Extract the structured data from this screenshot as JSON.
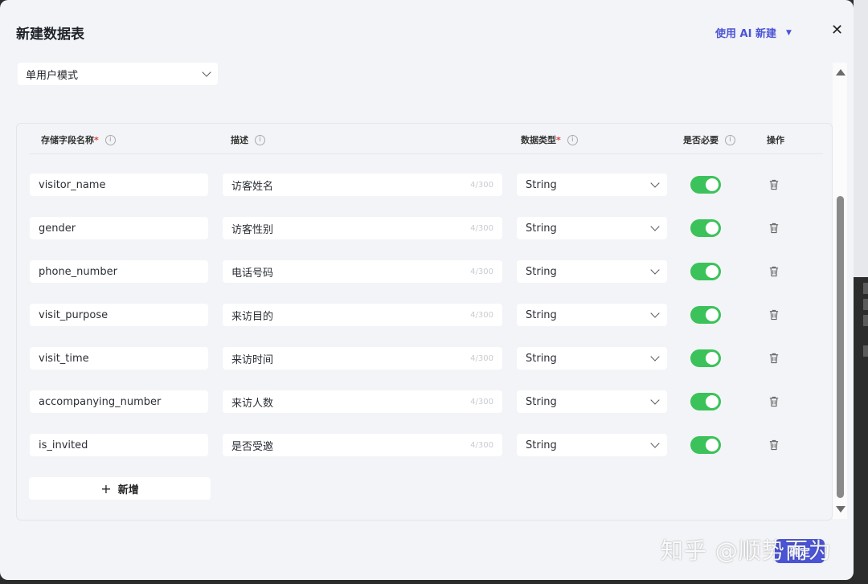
{
  "dialog": {
    "title": "新建数据表",
    "ai_new_label": "使用 AI 新建",
    "close_label": "✕",
    "mode_select": "单用户模式",
    "confirm_label": "确定"
  },
  "table": {
    "headers": {
      "name": "存储字段名称",
      "desc": "描述",
      "type": "数据类型",
      "required": "是否必要",
      "ops": "操作"
    },
    "required_mark": "*",
    "info_glyph": "i",
    "rows": [
      {
        "name": "visitor_name",
        "desc": "访客姓名",
        "count": "4/300",
        "type": "String",
        "required": true
      },
      {
        "name": "gender",
        "desc": "访客性别",
        "count": "4/300",
        "type": "String",
        "required": true
      },
      {
        "name": "phone_number",
        "desc": "电话号码",
        "count": "4/300",
        "type": "String",
        "required": true
      },
      {
        "name": "visit_purpose",
        "desc": "来访目的",
        "count": "4/300",
        "type": "String",
        "required": true
      },
      {
        "name": "visit_time",
        "desc": "来访时间",
        "count": "4/300",
        "type": "String",
        "required": true
      },
      {
        "name": "accompanying_number",
        "desc": "来访人数",
        "count": "4/300",
        "type": "String",
        "required": true
      },
      {
        "name": "is_invited",
        "desc": "是否受邀",
        "count": "4/300",
        "type": "String",
        "required": true
      }
    ],
    "add_label": "新增",
    "add_glyph": "+"
  },
  "watermark": "知乎 @顺势而为",
  "colors": {
    "accent": "#4b54d6",
    "toggle_on": "#3cc25a",
    "required_star": "#e0413d"
  }
}
